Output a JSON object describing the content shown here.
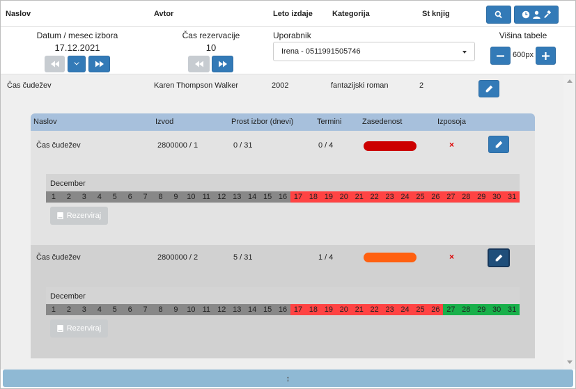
{
  "header": {
    "col_title": "Naslov",
    "col_author": "Avtor",
    "col_year": "Leto izdaje",
    "col_category": "Kategorija",
    "col_count": "St knjig"
  },
  "controls": {
    "date_label": "Datum / mesec izbora",
    "date_value": "17.12.2021",
    "reservation_label": "Čas rezervacije",
    "reservation_value": "10",
    "user_label": "Uporabnik",
    "user_value": "Irena - 0511991505746",
    "height_label": "Višina tabele",
    "height_value": "600px"
  },
  "book": {
    "title": "Čas čudežev",
    "author": "Karen Thompson Walker",
    "year": "2002",
    "category": "fantazijski roman",
    "count": "2"
  },
  "copies_header": {
    "title": "Naslov",
    "copy": "Izvod",
    "free": "Prost izbor (dnevi)",
    "terms": "Termini",
    "occupancy": "Zasedenost",
    "loan": "Izposoja"
  },
  "copies": [
    {
      "title": "Čas čudežev",
      "copy": "2800000 / 1",
      "free": "0 / 31",
      "terms": "0 / 4",
      "occupancy_color": "#cc0000",
      "loan": "×",
      "month": "December",
      "reserve_label": "Rezerviraj",
      "days": [
        {
          "n": "1",
          "s": "grey"
        },
        {
          "n": "2",
          "s": "grey"
        },
        {
          "n": "3",
          "s": "grey"
        },
        {
          "n": "4",
          "s": "grey"
        },
        {
          "n": "5",
          "s": "grey"
        },
        {
          "n": "6",
          "s": "grey"
        },
        {
          "n": "7",
          "s": "grey"
        },
        {
          "n": "8",
          "s": "grey"
        },
        {
          "n": "9",
          "s": "grey"
        },
        {
          "n": "10",
          "s": "grey"
        },
        {
          "n": "11",
          "s": "grey"
        },
        {
          "n": "12",
          "s": "grey"
        },
        {
          "n": "13",
          "s": "grey"
        },
        {
          "n": "14",
          "s": "grey"
        },
        {
          "n": "15",
          "s": "grey"
        },
        {
          "n": "16",
          "s": "grey"
        },
        {
          "n": "17",
          "s": "red"
        },
        {
          "n": "18",
          "s": "red"
        },
        {
          "n": "19",
          "s": "red"
        },
        {
          "n": "20",
          "s": "red"
        },
        {
          "n": "21",
          "s": "red"
        },
        {
          "n": "22",
          "s": "red"
        },
        {
          "n": "23",
          "s": "red"
        },
        {
          "n": "24",
          "s": "red"
        },
        {
          "n": "25",
          "s": "red"
        },
        {
          "n": "26",
          "s": "red"
        },
        {
          "n": "27",
          "s": "red"
        },
        {
          "n": "28",
          "s": "red"
        },
        {
          "n": "29",
          "s": "red"
        },
        {
          "n": "30",
          "s": "red"
        },
        {
          "n": "31",
          "s": "red"
        }
      ]
    },
    {
      "title": "Čas čudežev",
      "copy": "2800000 / 2",
      "free": "5 / 31",
      "terms": "1 / 4",
      "occupancy_color": "#ff6010",
      "loan": "×",
      "month": "December",
      "reserve_label": "Rezerviraj",
      "days": [
        {
          "n": "1",
          "s": "grey"
        },
        {
          "n": "2",
          "s": "grey"
        },
        {
          "n": "3",
          "s": "grey"
        },
        {
          "n": "4",
          "s": "grey"
        },
        {
          "n": "5",
          "s": "grey"
        },
        {
          "n": "6",
          "s": "grey"
        },
        {
          "n": "7",
          "s": "grey"
        },
        {
          "n": "8",
          "s": "grey"
        },
        {
          "n": "9",
          "s": "grey"
        },
        {
          "n": "10",
          "s": "grey"
        },
        {
          "n": "11",
          "s": "grey"
        },
        {
          "n": "12",
          "s": "grey"
        },
        {
          "n": "13",
          "s": "grey"
        },
        {
          "n": "14",
          "s": "grey"
        },
        {
          "n": "15",
          "s": "grey"
        },
        {
          "n": "16",
          "s": "grey"
        },
        {
          "n": "17",
          "s": "red"
        },
        {
          "n": "18",
          "s": "red"
        },
        {
          "n": "19",
          "s": "red"
        },
        {
          "n": "20",
          "s": "red"
        },
        {
          "n": "21",
          "s": "red"
        },
        {
          "n": "22",
          "s": "red"
        },
        {
          "n": "23",
          "s": "red"
        },
        {
          "n": "24",
          "s": "red"
        },
        {
          "n": "25",
          "s": "red"
        },
        {
          "n": "26",
          "s": "red"
        },
        {
          "n": "27",
          "s": "green"
        },
        {
          "n": "28",
          "s": "green"
        },
        {
          "n": "29",
          "s": "green"
        },
        {
          "n": "30",
          "s": "green"
        },
        {
          "n": "31",
          "s": "green"
        }
      ]
    }
  ],
  "bottom": {
    "resize_glyph": "↕"
  },
  "colors": {
    "accent": "#337ab7",
    "header_blue": "#a7c0dc",
    "grey_day": "#888888",
    "red_day": "#ff4343",
    "green_day": "#18b04a"
  }
}
